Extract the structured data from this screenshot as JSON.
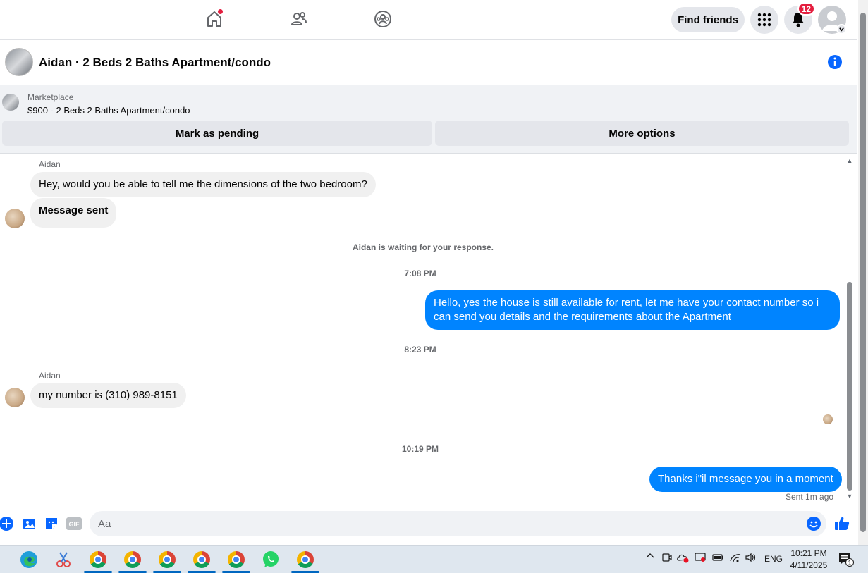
{
  "topnav": {
    "home_icon": "home-icon",
    "friends_icon": "friends-icon",
    "groups_icon": "groups-icon",
    "find_friends_label": "Find friends",
    "apps_icon": "grid-menu-icon",
    "notifications_icon": "bell-icon",
    "notifications_count": "12",
    "account_icon": "account-avatar"
  },
  "chat_header": {
    "title": "Aidan · 2 Beds 2 Baths Apartment/condo",
    "info_icon": "info-icon"
  },
  "marketplace": {
    "label": "Marketplace",
    "listing": "$900 - 2 Beds 2 Baths Apartment/condo",
    "mark_pending_label": "Mark as pending",
    "more_options_label": "More options"
  },
  "messages": {
    "sender_1": "Aidan",
    "msg_1": "Hey, would you be able to tell me the dimensions of the two bedroom?",
    "msg_2": "Message sent",
    "waiting": "Aidan is waiting for your response.",
    "time_1": "7:08 PM",
    "out_1": "Hello, yes the house is still available for rent, let me have your contact number so i can send you details and the requirements about the  Apartment",
    "time_2": "8:23 PM",
    "sender_2": "Aidan",
    "msg_3": "my number is (310) 989-8151",
    "time_3": "10:19 PM",
    "out_2": "Thanks i\"il message you in a moment",
    "sent_status": "Sent 1m ago"
  },
  "composer": {
    "placeholder": "Aa",
    "icons": [
      "plus-icon",
      "photo-icon",
      "sticker-icon",
      "gif-icon",
      "emoji-icon",
      "like-icon"
    ],
    "gif_label": "GIF"
  },
  "taskbar": {
    "apps": [
      "edge-icon",
      "snipping-icon",
      "chrome-icon",
      "chrome-icon",
      "chrome-icon",
      "chrome-icon",
      "chrome-icon",
      "whatsapp-icon",
      "chrome-icon"
    ],
    "language": "ENG",
    "time": "10:21 PM",
    "date": "4/11/2025",
    "notification_count": "1"
  },
  "colors": {
    "accent": "#0084ff",
    "badge": "#e41e3f",
    "bubble_in": "#f0f0f0"
  }
}
